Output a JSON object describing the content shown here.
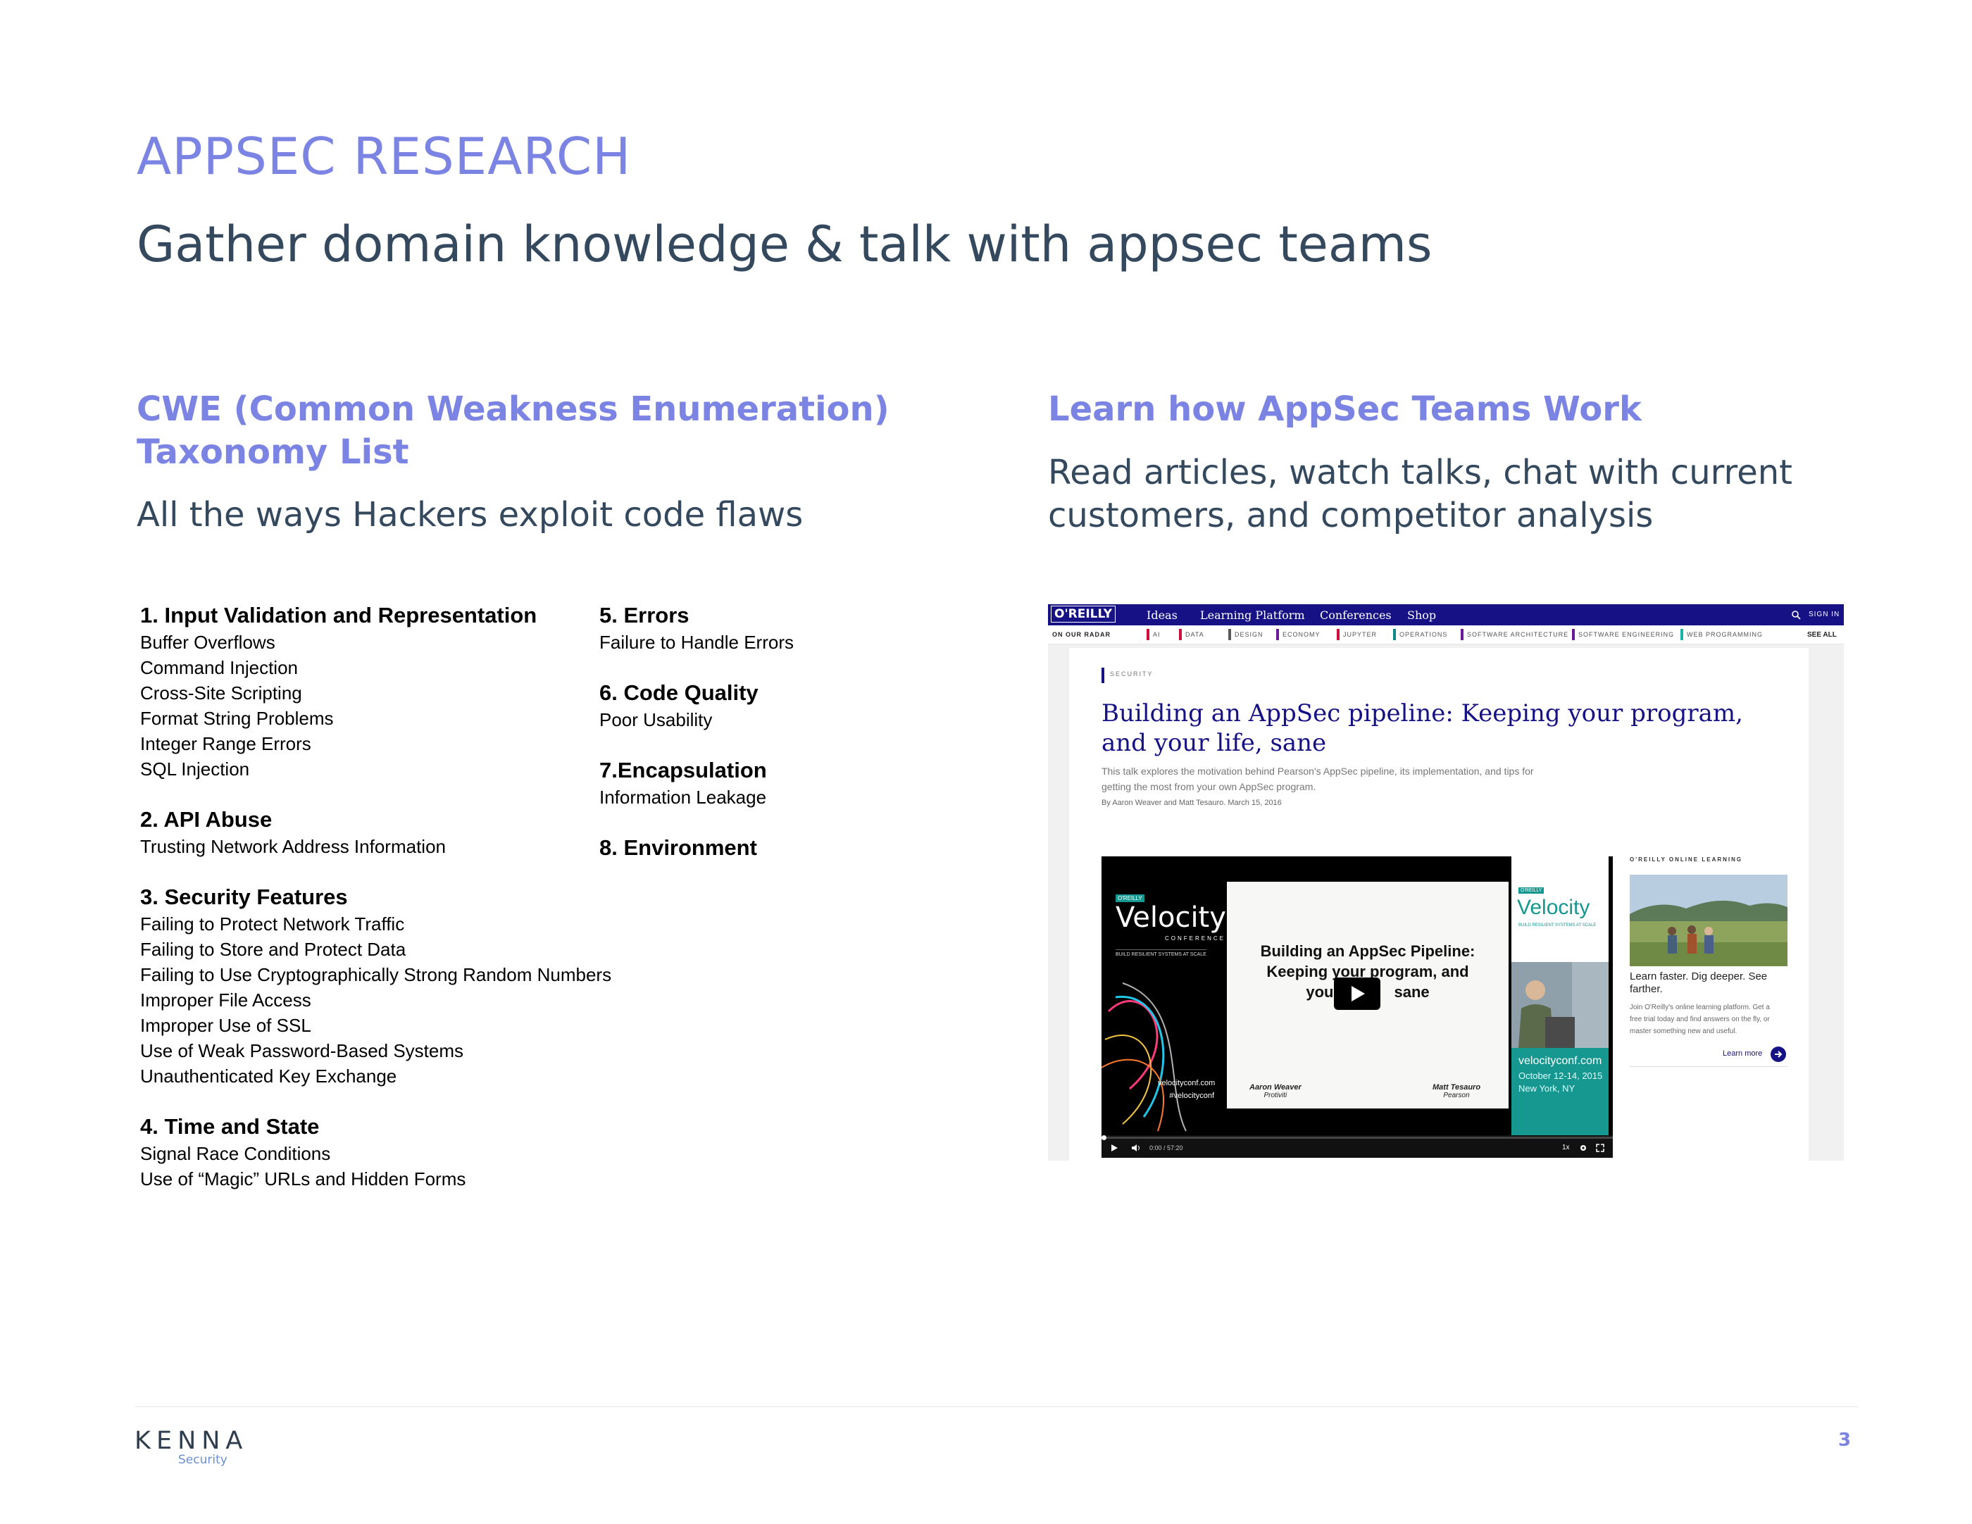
{
  "header": {
    "eyebrow": "APPSEC RESEARCH",
    "title": "Gather domain knowledge & talk with appsec teams"
  },
  "left_column": {
    "heading_line1": "CWE (Common Weakness Enumeration)",
    "heading_line2": "Taxonomy List",
    "subtitle": "All the ways Hackers exploit code flaws",
    "list_a": [
      {
        "title": "1. Input Validation and Representation",
        "items": [
          "Buffer Overflows",
          "Command Injection",
          "Cross-Site Scripting",
          "Format String Problems",
          "Integer Range Errors",
          "SQL Injection"
        ]
      },
      {
        "title": "2. API Abuse",
        "items": [
          "Trusting Network Address Information"
        ]
      },
      {
        "title": "3. Security Features",
        "items": [
          "Failing to Protect Network Traffic",
          "Failing to Store and Protect Data",
          "Failing to Use Cryptographically Strong Random Numbers",
          "Improper File Access",
          "Improper Use of SSL",
          "Use of Weak Password-Based Systems",
          "Unauthenticated Key Exchange"
        ]
      },
      {
        "title": "4. Time and State",
        "items": [
          "Signal Race Conditions",
          "Use of “Magic” URLs and Hidden Forms"
        ]
      }
    ],
    "list_b": [
      {
        "title": "5. Errors",
        "items": [
          "Failure to Handle Errors"
        ]
      },
      {
        "title": "6. Code Quality",
        "items": [
          "Poor Usability"
        ]
      },
      {
        "title": "7.Encapsulation",
        "items": [
          "Information Leakage"
        ]
      },
      {
        "title": "8. Environment",
        "items": []
      }
    ]
  },
  "right_column": {
    "heading": "Learn how AppSec Teams Work",
    "subtitle_line1": "Read articles, watch talks, chat with current",
    "subtitle_line2": "customers, and competitor analysis"
  },
  "screenshot": {
    "logo": "O'REILLY",
    "nav": [
      "Ideas",
      "Learning Platform",
      "Conferences",
      "Shop"
    ],
    "sign_in": "SIGN IN",
    "radar_label": "ON OUR RADAR",
    "topics": [
      {
        "label": "AI",
        "color": "#d0103a"
      },
      {
        "label": "DATA",
        "color": "#d0103a"
      },
      {
        "label": "DESIGN",
        "color": "#5a5a5a"
      },
      {
        "label": "ECONOMY",
        "color": "#6a1b9a"
      },
      {
        "label": "JUPYTER",
        "color": "#d0103a"
      },
      {
        "label": "OPERATIONS",
        "color": "#0f8a8a"
      },
      {
        "label": "SOFTWARE ARCHITECTURE",
        "color": "#6a1b9a"
      },
      {
        "label": "SOFTWARE ENGINEERING",
        "color": "#6a1b9a"
      },
      {
        "label": "WEB PROGRAMMING",
        "color": "#20b2aa"
      }
    ],
    "see_all": "SEE ALL",
    "category": "SECURITY",
    "article_title_line1": "Building an AppSec pipeline: Keeping your program,",
    "article_title_line2": "and your life, sane",
    "article_desc_line1": "This talk explores the motivation behind Pearson's AppSec pipeline, its implementation, and tips for",
    "article_desc_line2": "getting the most from your own AppSec program.",
    "byline": "By Aaron Weaver and Matt Tesauro. March 15, 2016",
    "video": {
      "brand_small": "O'REILLY",
      "brand": "Velocity",
      "brand_conf": "CONFERENCE",
      "brand_tagline": "BUILD RESILIENT SYSTEMS AT SCALE",
      "site": "velocityconf.com",
      "hashtag": "#velocityconf",
      "slide_title_line1": "Building an AppSec Pipeline:",
      "slide_title_line2": "Keeping your program, and",
      "slide_title_line3_a": "you",
      "slide_title_line3_b": "sane",
      "speaker1": "Aaron Weaver",
      "speaker1_org": "Protiviti",
      "speaker2": "Matt Tesauro",
      "speaker2_org": "Pearson",
      "side_site": "velocityconf.com",
      "side_dates": "October 12-14, 2015",
      "side_city": "New York, NY",
      "time": "0:00 / 57:20",
      "speed": "1x"
    },
    "promo": {
      "label": "O'REILLY ONLINE LEARNING",
      "headline_line1": "Learn faster. Dig deeper. See",
      "headline_line2": "farther.",
      "body_line1": "Join O'Reilly's online learning platform. Get a",
      "body_line2": "free trial today and find answers on the fly, or",
      "body_line3": "master something new and useful.",
      "link": "Learn more"
    }
  },
  "footer": {
    "brand": "KENNA",
    "brand_sub": "Security",
    "page_number": "3"
  },
  "colors": {
    "accent": "#7b83e3",
    "heading_dark": "#35495e",
    "oreilly_nav": "#161184",
    "teal": "#16978f"
  }
}
